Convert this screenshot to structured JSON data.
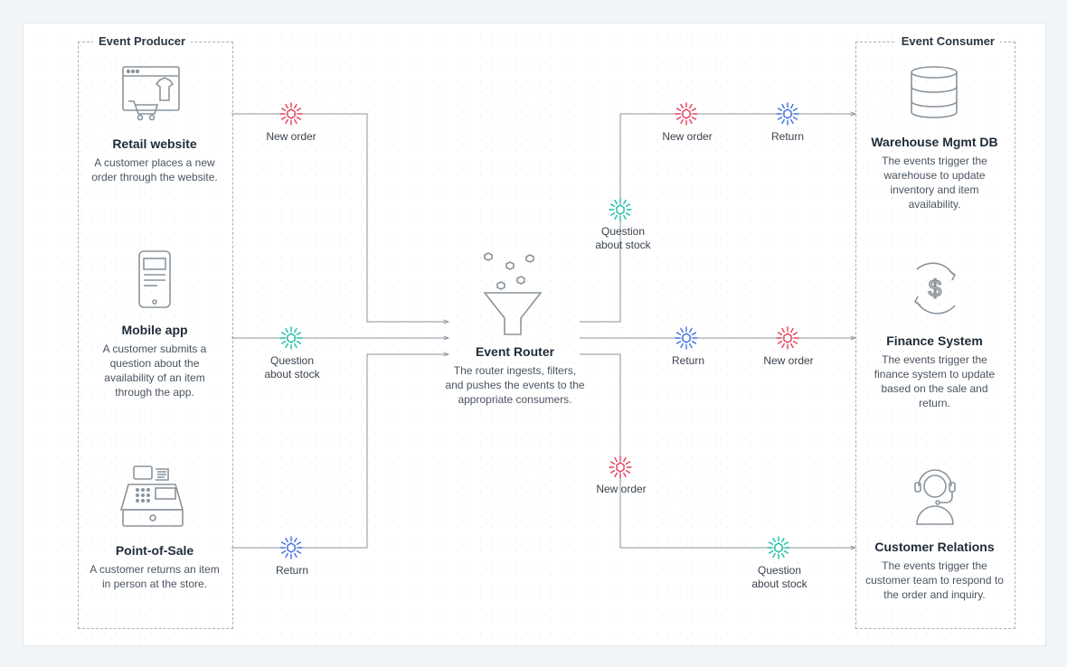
{
  "groups": {
    "producer": "Event Producer",
    "consumer": "Event Consumer"
  },
  "producers": {
    "retail": {
      "title": "Retail website",
      "desc": "A customer places a new order through the website."
    },
    "mobile": {
      "title": "Mobile app",
      "desc": "A customer submits a question about the availability of an item through the app."
    },
    "pos": {
      "title": "Point-of-Sale",
      "desc": "A customer returns an item in person at the store."
    }
  },
  "router": {
    "title": "Event Router",
    "desc": "The router ingests, filters, and pushes the events to the appropriate consumers."
  },
  "consumers": {
    "warehouse": {
      "title": "Warehouse Mgmt DB",
      "desc": "The events trigger the warehouse to update inventory and item availability."
    },
    "finance": {
      "title": "Finance System",
      "desc": "The events trigger the finance system to update based on the sale and return."
    },
    "cr": {
      "title": "Customer Relations",
      "desc": "The events trigger the customer team to respond to the order and inquiry."
    }
  },
  "events": {
    "p_new_order": "New order",
    "p_question": "Question\nabout stock",
    "p_return": "Return",
    "top_question": "Question\nabout stock",
    "top_neworder": "New order",
    "top_return": "Return",
    "mid_return": "Return",
    "mid_neworder": "New order",
    "bot_neworder": "New order",
    "bot_question": "Question\nabout stock"
  },
  "colors": {
    "red": "#e63c5a",
    "teal": "#1cbfa8",
    "blue": "#3f6fe0",
    "grey": "#8a949c"
  }
}
